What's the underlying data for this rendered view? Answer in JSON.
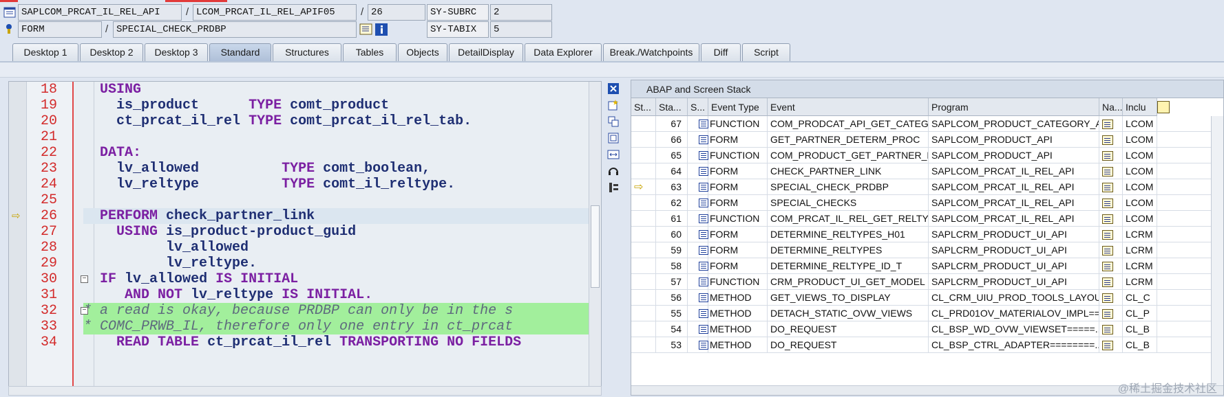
{
  "header": {
    "row1": {
      "program": "SAPLCOM_PRCAT_IL_REL_API",
      "include": "LCOM_PRCAT_IL_REL_APIF05",
      "line": "26",
      "sysvar_label": "SY-SUBRC",
      "sysvar_value": "2"
    },
    "row2": {
      "event_type": "FORM",
      "event_name": "SPECIAL_CHECK_PRDBP",
      "sysvar_label": "SY-TABIX",
      "sysvar_value": "5"
    }
  },
  "tabs": [
    {
      "label": "Desktop 1"
    },
    {
      "label": "Desktop 2"
    },
    {
      "label": "Desktop 3"
    },
    {
      "label": "Standard"
    },
    {
      "label": "Structures"
    },
    {
      "label": "Tables"
    },
    {
      "label": "Objects"
    },
    {
      "label": "DetailDisplay"
    },
    {
      "label": "Data Explorer"
    },
    {
      "label": "Break./Watchpoints"
    },
    {
      "label": "Diff"
    },
    {
      "label": "Script"
    }
  ],
  "active_tab": "Standard",
  "source": {
    "lines": [
      {
        "num": "18",
        "html": "  <span class='kw'>USING</span>"
      },
      {
        "num": "19",
        "html": "    <span class='id'>is_product</span>      <span class='kw'>TYPE</span> <span class='id'>comt_product</span>"
      },
      {
        "num": "20",
        "html": "    <span class='id'>ct_prcat_il_rel</span> <span class='kw'>TYPE</span> <span class='id'>comt_prcat_il_rel_tab.</span>"
      },
      {
        "num": "21",
        "html": ""
      },
      {
        "num": "22",
        "html": "  <span class='kw'>DATA:</span>"
      },
      {
        "num": "23",
        "html": "    <span class='id'>lv_allowed</span>          <span class='kw'>TYPE</span> <span class='id'>comt_boolean,</span>"
      },
      {
        "num": "24",
        "html": "    <span class='id'>lv_reltype</span>          <span class='kw'>TYPE</span> <span class='id'>comt_il_reltype.</span>"
      },
      {
        "num": "25",
        "html": ""
      },
      {
        "num": "26",
        "html": "  <span class='kw'>PERFORM</span> <span class='id'>check_partner_link</span>"
      },
      {
        "num": "27",
        "html": "    <span class='kw'>USING</span> <span class='id'>is_product-product_guid</span>"
      },
      {
        "num": "28",
        "html": "          <span class='id'>lv_allowed</span>"
      },
      {
        "num": "29",
        "html": "          <span class='id'>lv_reltype.</span>"
      },
      {
        "num": "30",
        "html": "  <span class='kw'>IF</span> <span class='id'>lv_allowed</span> <span class='kw'>IS INITIAL</span>"
      },
      {
        "num": "31",
        "html": "     <span class='kw'>AND NOT</span> <span class='id'>lv_reltype</span> <span class='kw'>IS INITIAL.</span>"
      },
      {
        "num": "32",
        "html": "<span class='cmt'>* a read is okay, because PRDBP can only be in the s</span>"
      },
      {
        "num": "33",
        "html": "<span class='cmt'>* COMC_PRWB_IL, therefore only one entry in ct_prcat</span>"
      },
      {
        "num": "34",
        "html": "    <span class='kw'>READ TABLE</span> <span class='id'>ct_prcat_il_rel</span> <span class='kw'>TRANSPORTING NO FIELDS</span>"
      }
    ]
  },
  "stack": {
    "title": "ABAP and Screen Stack",
    "columns": [
      "St...",
      "Sta...",
      "S...",
      "Event Type",
      "Event",
      "Program",
      "Na...",
      "Inclu"
    ],
    "rows": [
      {
        "level": "67",
        "type": "FUNCTION",
        "event": "COM_PRODCAT_API_GET_CATEGORI...",
        "program": "SAPLCOM_PRODUCT_CATEGORY_API",
        "include": "LCOM"
      },
      {
        "level": "66",
        "type": "FORM",
        "event": "GET_PARTNER_DETERM_PROC",
        "program": "SAPLCOM_PRODUCT_API",
        "include": "LCOM"
      },
      {
        "level": "65",
        "type": "FUNCTION",
        "event": "COM_PRODUCT_GET_PARTNER_PROC",
        "program": "SAPLCOM_PRODUCT_API",
        "include": "LCOM"
      },
      {
        "level": "64",
        "type": "FORM",
        "event": "CHECK_PARTNER_LINK",
        "program": "SAPLCOM_PRCAT_IL_REL_API",
        "include": "LCOM"
      },
      {
        "level": "63",
        "type": "FORM",
        "event": "SPECIAL_CHECK_PRDBP",
        "program": "SAPLCOM_PRCAT_IL_REL_API",
        "include": "LCOM",
        "current": true
      },
      {
        "level": "62",
        "type": "FORM",
        "event": "SPECIAL_CHECKS",
        "program": "SAPLCOM_PRCAT_IL_REL_API",
        "include": "LCOM"
      },
      {
        "level": "61",
        "type": "FUNCTION",
        "event": "COM_PRCAT_IL_REL_GET_RELTYPES",
        "program": "SAPLCOM_PRCAT_IL_REL_API",
        "include": "LCOM"
      },
      {
        "level": "60",
        "type": "FORM",
        "event": "DETERMINE_RELTYPES_H01",
        "program": "SAPLCRM_PRODUCT_UI_API",
        "include": "LCRM"
      },
      {
        "level": "59",
        "type": "FORM",
        "event": "DETERMINE_RELTYPES",
        "program": "SAPLCRM_PRODUCT_UI_API",
        "include": "LCRM"
      },
      {
        "level": "58",
        "type": "FORM",
        "event": "DETERMINE_RELTYPE_ID_T",
        "program": "SAPLCRM_PRODUCT_UI_API",
        "include": "LCRM"
      },
      {
        "level": "57",
        "type": "FUNCTION",
        "event": "CRM_PRODUCT_UI_GET_MODEL",
        "program": "SAPLCRM_PRODUCT_UI_API",
        "include": "LCRM"
      },
      {
        "level": "56",
        "type": "METHOD",
        "event": "GET_VIEWS_TO_DISPLAY",
        "program": "CL_CRM_UIU_PROD_TOOLS_LAYOUT...",
        "include": "CL_C"
      },
      {
        "level": "55",
        "type": "METHOD",
        "event": "DETACH_STATIC_OVW_VIEWS",
        "program": "CL_PRD01OV_MATERIALOV_IMPL===...",
        "include": "CL_P"
      },
      {
        "level": "54",
        "type": "METHOD",
        "event": "DO_REQUEST",
        "program": "CL_BSP_WD_OVW_VIEWSET=====...",
        "include": "CL_B"
      },
      {
        "level": "53",
        "type": "METHOD",
        "event": "DO_REQUEST",
        "program": "CL_BSP_CTRL_ADAPTER========...",
        "include": "CL_B"
      }
    ]
  },
  "watermark": "@稀土掘金技术社区",
  "icons": {
    "program": "program-icon",
    "event": "event-icon",
    "source_nav": "source-nav-icon",
    "info": "info-icon",
    "close": "close-icon",
    "new": "new-icon",
    "current_line": "current-line-arrow-icon"
  }
}
